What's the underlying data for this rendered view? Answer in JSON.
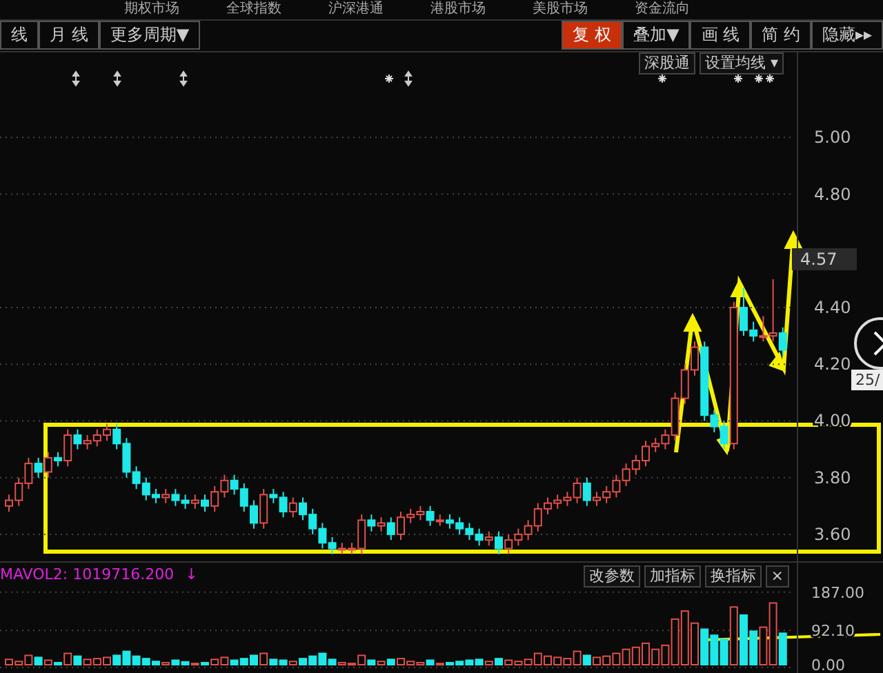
{
  "top_menu": [
    "期权市场",
    "全球指数",
    "沪深港通",
    "港股市场",
    "美股市场",
    "资金流向"
  ],
  "toolbar": {
    "left": [
      {
        "label": "线"
      },
      {
        "label": "月 线"
      },
      {
        "label": "更多周期▼"
      }
    ],
    "right": [
      {
        "label": "复 权",
        "selected": true
      },
      {
        "label": "叠加▼",
        "selected": false
      },
      {
        "label": "画 线",
        "selected": false
      },
      {
        "label": "简 约",
        "selected": false
      },
      {
        "label": "隐藏▸▸",
        "selected": false
      }
    ]
  },
  "chart_tools": [
    "深股通",
    "设置均线 ▾"
  ],
  "price_chart": {
    "current_price": "4.57",
    "date_tooltip": "25/",
    "chart_data": {
      "type": "candlestick",
      "grid": true,
      "ylim": [
        3.5,
        5.3
      ],
      "yticks": [
        {
          "value": 3.6,
          "label": "3.60"
        },
        {
          "value": 3.8,
          "label": "3.80"
        },
        {
          "value": 4.0,
          "label": "4.00"
        },
        {
          "value": 4.2,
          "label": "4.20"
        },
        {
          "value": 4.4,
          "label": "4.40"
        },
        {
          "value": 4.8,
          "label": "4.80"
        },
        {
          "value": 5.0,
          "label": "5.00"
        }
      ],
      "ohlc": [
        [
          3.7,
          3.74,
          3.68,
          3.72
        ],
        [
          3.72,
          3.8,
          3.7,
          3.78
        ],
        [
          3.78,
          3.87,
          3.76,
          3.85
        ],
        [
          3.85,
          3.87,
          3.8,
          3.82
        ],
        [
          3.82,
          3.89,
          3.8,
          3.87
        ],
        [
          3.87,
          3.89,
          3.84,
          3.86
        ],
        [
          3.86,
          3.97,
          3.84,
          3.95
        ],
        [
          3.95,
          3.97,
          3.9,
          3.92
        ],
        [
          3.92,
          3.95,
          3.9,
          3.93
        ],
        [
          3.93,
          3.97,
          3.91,
          3.95
        ],
        [
          3.95,
          3.99,
          3.93,
          3.97
        ],
        [
          3.97,
          3.99,
          3.9,
          3.92
        ],
        [
          3.92,
          3.94,
          3.8,
          3.82
        ],
        [
          3.82,
          3.84,
          3.76,
          3.78
        ],
        [
          3.78,
          3.8,
          3.72,
          3.74
        ],
        [
          3.74,
          3.76,
          3.71,
          3.73
        ],
        [
          3.73,
          3.76,
          3.71,
          3.74
        ],
        [
          3.74,
          3.76,
          3.7,
          3.72
        ],
        [
          3.72,
          3.74,
          3.69,
          3.71
        ],
        [
          3.71,
          3.74,
          3.69,
          3.72
        ],
        [
          3.72,
          3.74,
          3.68,
          3.7
        ],
        [
          3.7,
          3.77,
          3.68,
          3.75
        ],
        [
          3.75,
          3.81,
          3.73,
          3.79
        ],
        [
          3.79,
          3.81,
          3.74,
          3.76
        ],
        [
          3.76,
          3.78,
          3.68,
          3.7
        ],
        [
          3.7,
          3.72,
          3.62,
          3.64
        ],
        [
          3.64,
          3.76,
          3.62,
          3.74
        ],
        [
          3.74,
          3.76,
          3.71,
          3.73
        ],
        [
          3.73,
          3.75,
          3.66,
          3.68
        ],
        [
          3.68,
          3.73,
          3.66,
          3.71
        ],
        [
          3.71,
          3.73,
          3.65,
          3.67
        ],
        [
          3.67,
          3.69,
          3.6,
          3.62
        ],
        [
          3.62,
          3.64,
          3.55,
          3.57
        ],
        [
          3.57,
          3.59,
          3.53,
          3.55
        ],
        [
          3.55,
          3.57,
          3.53,
          3.55
        ],
        [
          3.55,
          3.57,
          3.53,
          3.55
        ],
        [
          3.55,
          3.67,
          3.53,
          3.65
        ],
        [
          3.65,
          3.67,
          3.61,
          3.63
        ],
        [
          3.63,
          3.66,
          3.61,
          3.64
        ],
        [
          3.64,
          3.66,
          3.58,
          3.6
        ],
        [
          3.6,
          3.68,
          3.58,
          3.66
        ],
        [
          3.66,
          3.69,
          3.64,
          3.67
        ],
        [
          3.67,
          3.7,
          3.65,
          3.68
        ],
        [
          3.68,
          3.7,
          3.63,
          3.65
        ],
        [
          3.65,
          3.67,
          3.63,
          3.65
        ],
        [
          3.65,
          3.67,
          3.62,
          3.64
        ],
        [
          3.64,
          3.66,
          3.6,
          3.62
        ],
        [
          3.62,
          3.64,
          3.58,
          3.6
        ],
        [
          3.6,
          3.62,
          3.56,
          3.58
        ],
        [
          3.58,
          3.61,
          3.56,
          3.59
        ],
        [
          3.59,
          3.61,
          3.53,
          3.55
        ],
        [
          3.55,
          3.6,
          3.53,
          3.58
        ],
        [
          3.58,
          3.62,
          3.56,
          3.6
        ],
        [
          3.6,
          3.65,
          3.58,
          3.63
        ],
        [
          3.63,
          3.71,
          3.61,
          3.69
        ],
        [
          3.69,
          3.73,
          3.67,
          3.71
        ],
        [
          3.71,
          3.74,
          3.69,
          3.72
        ],
        [
          3.72,
          3.75,
          3.7,
          3.73
        ],
        [
          3.73,
          3.8,
          3.71,
          3.78
        ],
        [
          3.78,
          3.8,
          3.7,
          3.72
        ],
        [
          3.72,
          3.75,
          3.7,
          3.73
        ],
        [
          3.73,
          3.77,
          3.71,
          3.75
        ],
        [
          3.75,
          3.81,
          3.73,
          3.79
        ],
        [
          3.79,
          3.85,
          3.77,
          3.83
        ],
        [
          3.83,
          3.88,
          3.81,
          3.86
        ],
        [
          3.86,
          3.93,
          3.84,
          3.91
        ],
        [
          3.91,
          3.94,
          3.89,
          3.92
        ],
        [
          3.92,
          3.97,
          3.9,
          3.95
        ],
        [
          3.95,
          4.1,
          3.93,
          4.08
        ],
        [
          4.08,
          4.2,
          4.06,
          4.18
        ],
        [
          4.18,
          4.28,
          4.16,
          4.26
        ],
        [
          4.26,
          4.28,
          4.0,
          4.02
        ],
        [
          4.02,
          4.04,
          3.96,
          3.98
        ],
        [
          3.98,
          4.0,
          3.9,
          3.92
        ],
        [
          3.92,
          4.42,
          3.9,
          4.4
        ],
        [
          4.4,
          4.47,
          4.3,
          4.32
        ],
        [
          4.32,
          4.35,
          4.28,
          4.3
        ],
        [
          4.3,
          4.37,
          4.28,
          4.3
        ],
        [
          4.3,
          4.5,
          4.28,
          4.31
        ],
        [
          4.31,
          4.33,
          4.23,
          4.25
        ]
      ]
    }
  },
  "volume_panel": {
    "indicator": "MAVOL2: 1019716.200",
    "trend_arrow": "↓",
    "buttons": [
      "改参数",
      "加指标",
      "换指标",
      "×"
    ],
    "chart_data": {
      "type": "bar",
      "grid": true,
      "ylim": [
        0,
        260
      ],
      "yticks": [
        {
          "value": 187,
          "label": "187.00"
        },
        {
          "value": 92.1,
          "label": "92.10"
        },
        {
          "value": 0,
          "label": "0.00"
        }
      ],
      "values": [
        20,
        15,
        30,
        25,
        18,
        12,
        35,
        28,
        20,
        22,
        25,
        30,
        40,
        28,
        22,
        15,
        12,
        18,
        14,
        10,
        12,
        20,
        25,
        18,
        22,
        30,
        35,
        20,
        18,
        15,
        22,
        28,
        35,
        20,
        12,
        10,
        30,
        18,
        15,
        20,
        22,
        15,
        12,
        18,
        10,
        12,
        15,
        18,
        20,
        15,
        22,
        18,
        15,
        20,
        35,
        28,
        25,
        22,
        40,
        30,
        25,
        28,
        35,
        45,
        50,
        60,
        45,
        55,
        120,
        140,
        110,
        95,
        80,
        70,
        150,
        130,
        90,
        100,
        160,
        85
      ]
    }
  }
}
